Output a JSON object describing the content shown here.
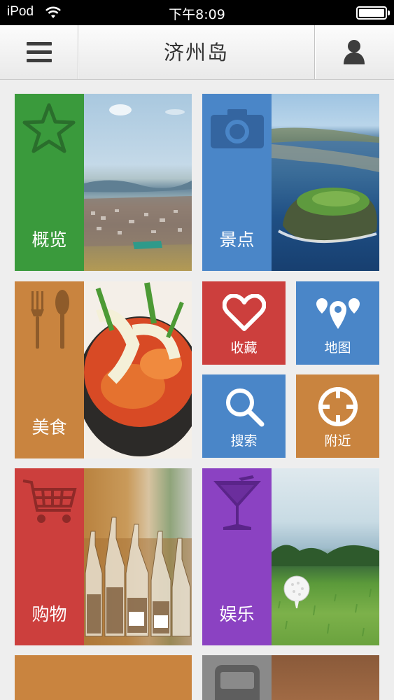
{
  "status_bar": {
    "carrier": "iPod",
    "time": "下午8:09",
    "battery_level": 1.0
  },
  "navbar": {
    "title": "济州岛"
  },
  "tiles": {
    "overview": {
      "label": "概览",
      "color": "#3a9a3c",
      "icon": "star-icon"
    },
    "sights": {
      "label": "景点",
      "color": "#4a86c8",
      "icon": "camera-icon"
    },
    "food": {
      "label": "美食",
      "color": "#c9843f",
      "icon": "fork-spoon-icon"
    },
    "shopping": {
      "label": "购物",
      "color": "#cc3f3d",
      "icon": "cart-icon"
    },
    "leisure": {
      "label": "娱乐",
      "color": "#8b42c2",
      "icon": "cocktail-icon"
    }
  },
  "small_tiles": {
    "favorites": {
      "label": "收藏",
      "color": "#cc3f3d",
      "icon": "heart-icon"
    },
    "map": {
      "label": "地图",
      "color": "#4a86c8",
      "icon": "map-pin-icon"
    },
    "search": {
      "label": "搜索",
      "color": "#4a86c8",
      "icon": "search-icon"
    },
    "nearby": {
      "label": "附近",
      "color": "#c9843f",
      "icon": "crosshair-icon"
    }
  },
  "partial_tiles": {
    "bottom_left": {
      "color": "#c9843f"
    },
    "bottom_right": {
      "color": "#8a8a8a",
      "icon": "bus-icon"
    }
  }
}
